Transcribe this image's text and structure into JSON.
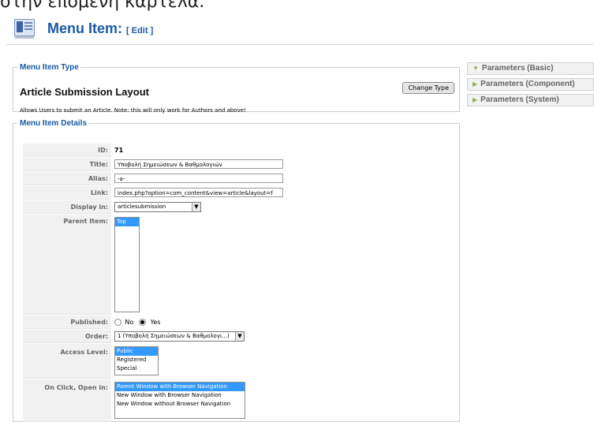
{
  "top_caption": "στην επόμενη καρτέλα.",
  "header": {
    "title": "Menu Item:",
    "edit_label": "[ Edit ]"
  },
  "type_section": {
    "legend": "Menu Item Type",
    "title": "Article Submission Layout",
    "change_button": "Change Type",
    "description": "Allows Users to submit an Article. Note: this will only work for Authors and above!"
  },
  "details": {
    "legend": "Menu Item Details",
    "id": {
      "label": "ID:",
      "value": "71"
    },
    "title": {
      "label": "Title:",
      "value": "Υποβολή Σημειώσεων & Βαθμολογιών"
    },
    "alias": {
      "label": "Alias:",
      "value": "-a-"
    },
    "link": {
      "label": "Link:",
      "value": "index.php?option=com_content&view=article&layout=f"
    },
    "display_in": {
      "label": "Display in:",
      "value": "articlesubmission"
    },
    "parent_item": {
      "label": "Parent Item:",
      "options": [
        "Top"
      ]
    },
    "published": {
      "label": "Published:",
      "no": "No",
      "yes": "Yes",
      "selected": "Yes"
    },
    "order": {
      "label": "Order:",
      "value": "1 (Υποβολή Σημειώσεων & Βαθμολογι...)"
    },
    "access_level": {
      "label": "Access Level:",
      "options": [
        "Public",
        "Registered",
        "Special"
      ],
      "selected": "Public"
    },
    "on_click": {
      "label": "On Click, Open in:",
      "options": [
        "Parent Window with Browser Navigation",
        "New Window with Browser Navigation",
        "New Window without Browser Navigation"
      ],
      "selected": "Parent Window with Browser Navigation"
    }
  },
  "panels": [
    {
      "label": "Parameters (Basic)",
      "expanded": true
    },
    {
      "label": "Parameters (Component)",
      "expanded": false
    },
    {
      "label": "Parameters (System)",
      "expanded": false
    }
  ],
  "colors": {
    "accent": "#1a5aa6",
    "selection": "#3399ff",
    "panel_arrow": "#8fb04d"
  }
}
